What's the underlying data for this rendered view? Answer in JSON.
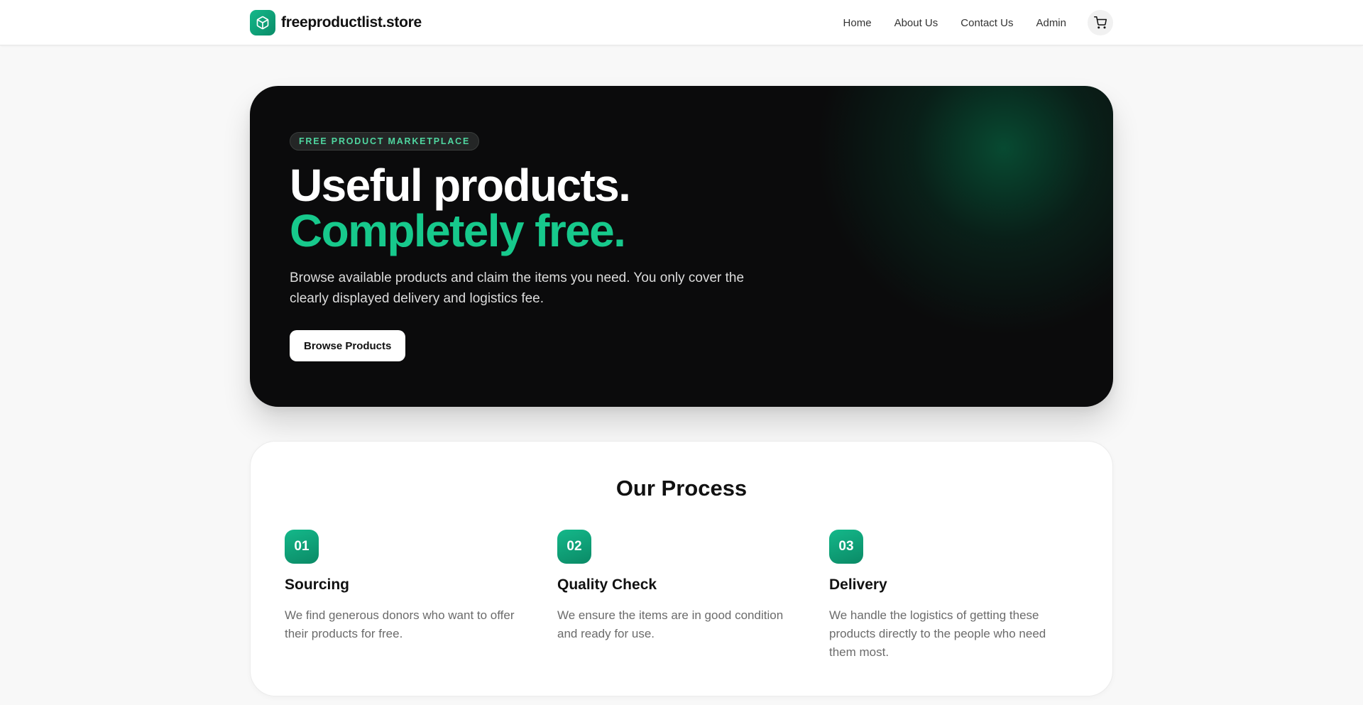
{
  "header": {
    "brand_name": "freeproductlist.store",
    "brand_icon": "package-box-icon",
    "nav": [
      {
        "label": "Home"
      },
      {
        "label": "About Us"
      },
      {
        "label": "Contact Us"
      },
      {
        "label": "Admin"
      }
    ],
    "cart_icon": "shopping-cart-icon"
  },
  "hero": {
    "badge": "FREE PRODUCT MARKETPLACE",
    "title_line1": "Useful products.",
    "title_line2": "Completely free.",
    "description": "Browse available products and claim the items you need. You only cover the clearly displayed delivery and logistics fee.",
    "cta_label": "Browse Products"
  },
  "process": {
    "title": "Our Process",
    "steps": [
      {
        "number": "01",
        "title": "Sourcing",
        "text": "We find generous donors who want to offer their products for free."
      },
      {
        "number": "02",
        "title": "Quality Check",
        "text": "We ensure the items are in good condition and ready for use."
      },
      {
        "number": "03",
        "title": "Delivery",
        "text": "We handle the logistics of getting these products directly to the people who need them most."
      }
    ]
  },
  "colors": {
    "accent": "#17c98c",
    "accent_dark": "#0b8a66",
    "hero_background": "#0b0b0c",
    "page_background": "#f8f8f8"
  }
}
